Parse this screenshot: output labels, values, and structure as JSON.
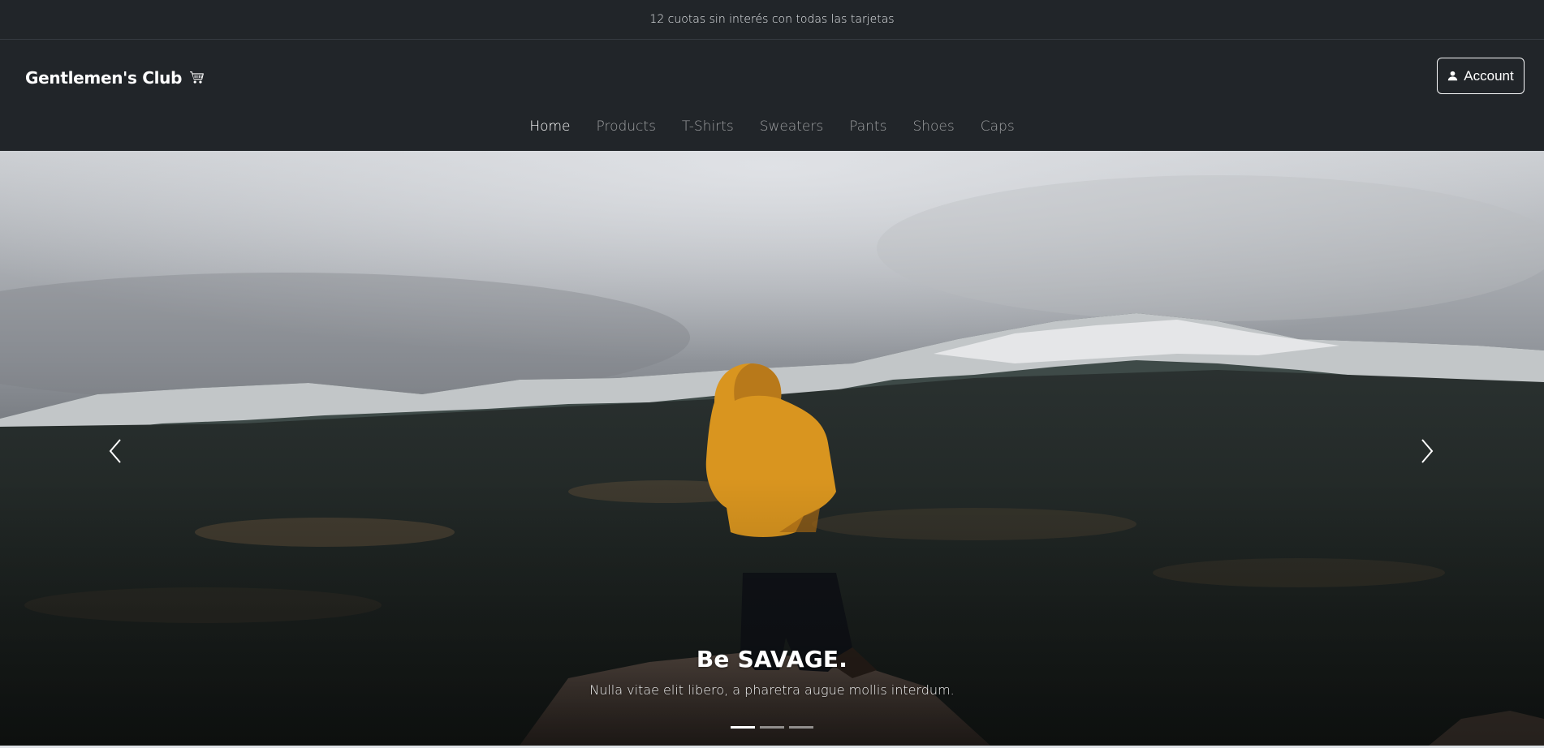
{
  "promo": {
    "text": "12 cuotas sin interés con todas las tarjetas"
  },
  "header": {
    "brand": "Gentlemen's Club",
    "brand_icon": "cart-icon",
    "account": {
      "label": "Account",
      "icon": "user-icon"
    }
  },
  "nav": {
    "items": [
      {
        "label": "Home",
        "active": true
      },
      {
        "label": "Products",
        "active": false
      },
      {
        "label": "T-Shirts",
        "active": false
      },
      {
        "label": "Sweaters",
        "active": false
      },
      {
        "label": "Pants",
        "active": false
      },
      {
        "label": "Shoes",
        "active": false
      },
      {
        "label": "Caps",
        "active": false
      }
    ]
  },
  "carousel": {
    "slides_count": 3,
    "active_index": 0,
    "caption": {
      "title": "Be SAVAGE.",
      "text": "Nulla vitae elit libero, a pharetra augue mollis interdum."
    },
    "prev_icon": "chevron-left-icon",
    "next_icon": "chevron-right-icon"
  },
  "colors": {
    "navbar_bg": "#212529",
    "jacket": "#d9951f",
    "text_muted": "rgba(255,255,255,0.55)"
  }
}
